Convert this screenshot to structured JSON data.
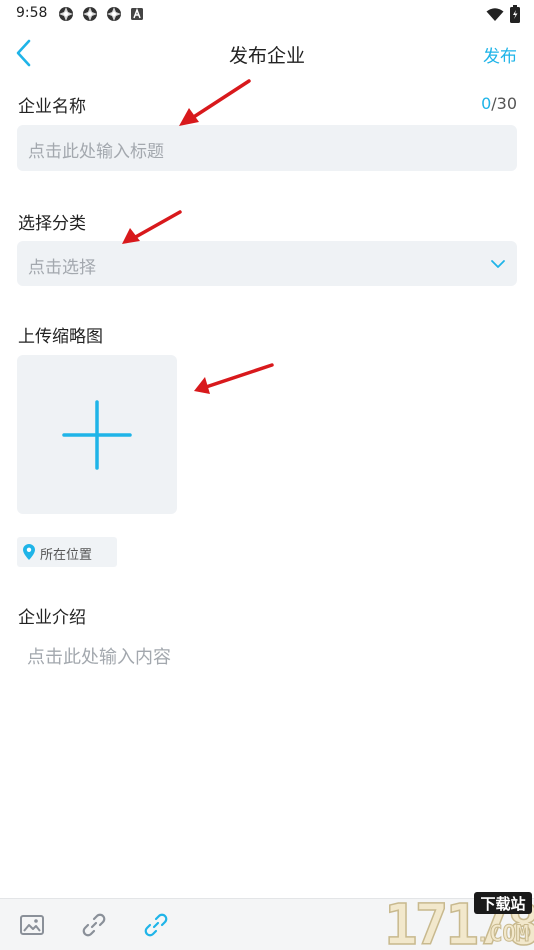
{
  "status_bar": {
    "time": "9:58",
    "left_icons": [
      "app-icon",
      "app-icon",
      "app-icon",
      "a-icon"
    ],
    "right_icons": [
      "wifi-icon",
      "battery-icon"
    ]
  },
  "nav": {
    "title": "发布企业",
    "action": "发布",
    "back_icon": "chevron-left-icon"
  },
  "company_name": {
    "label": "企业名称",
    "counter_current": "0",
    "counter_max": "/30",
    "placeholder": "点击此处输入标题"
  },
  "category": {
    "label": "选择分类",
    "placeholder": "点击选择"
  },
  "thumbnail": {
    "label": "上传缩略图"
  },
  "location": {
    "label": "所在位置"
  },
  "intro": {
    "label": "企业介绍",
    "placeholder": "点击此处输入内容"
  },
  "toolbar": {
    "items": [
      "image-icon",
      "link-icon",
      "link-icon"
    ]
  },
  "watermark": {
    "number": "17178",
    "badge": "下载站",
    "suffix": ".COM"
  },
  "colors": {
    "accent": "#1fb4e8",
    "field_bg": "#eff2f5",
    "annotation_arrow": "#d8191c"
  }
}
